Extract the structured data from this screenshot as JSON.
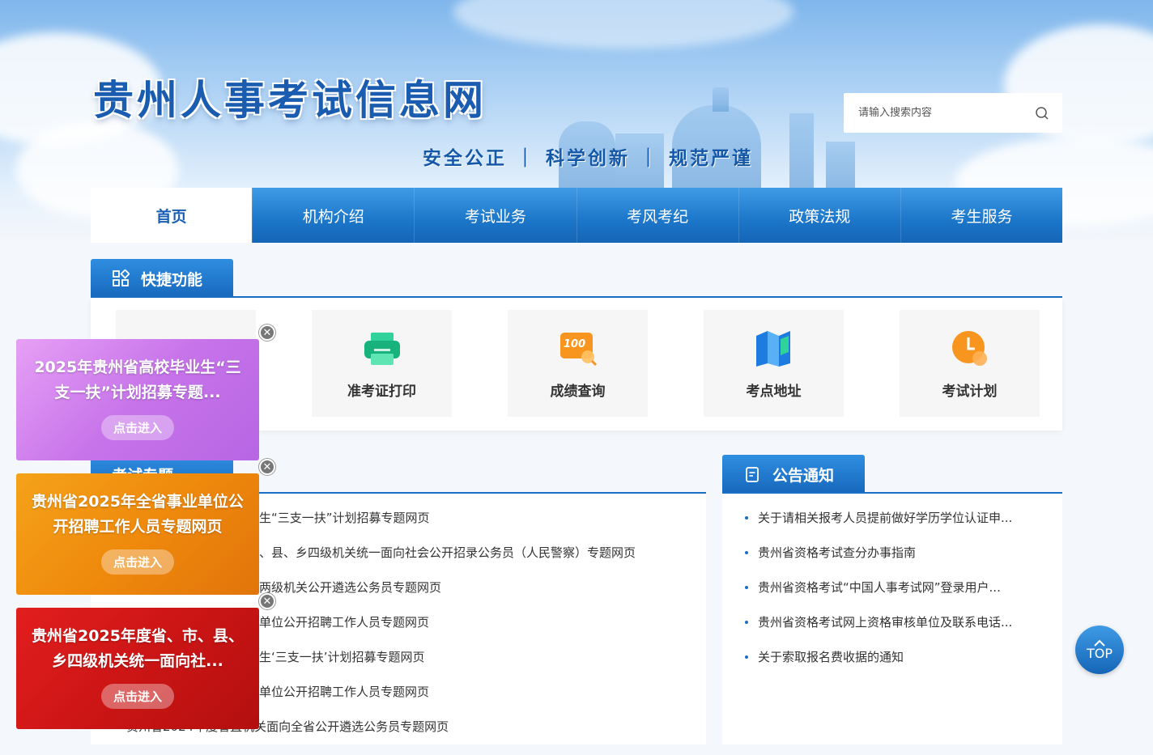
{
  "site": {
    "title": "贵州人事考试信息网",
    "slogan": "安全公正 ｜ 科学创新 ｜ 规范严谨"
  },
  "search": {
    "placeholder": "请输入搜索内容",
    "icon": "search-icon"
  },
  "nav": {
    "items": [
      {
        "label": "首页",
        "active": true
      },
      {
        "label": "机构介绍"
      },
      {
        "label": "考试业务"
      },
      {
        "label": "考风考纪"
      },
      {
        "label": "政策法规"
      },
      {
        "label": "考生服务"
      }
    ]
  },
  "quick": {
    "title": "快捷功能",
    "icon": "grid-icon",
    "items": [
      {
        "label": "",
        "icon": "blue-icon"
      },
      {
        "label": "准考证打印",
        "icon": "printer-icon"
      },
      {
        "label": "成绩查询",
        "icon": "score-icon",
        "badge": "100"
      },
      {
        "label": "考点地址",
        "icon": "map-icon"
      },
      {
        "label": "考试计划",
        "icon": "clock-icon"
      }
    ]
  },
  "topics": {
    "title": "考试专题",
    "items": [
      "生“三支一扶”计划招募专题网页",
      "、县、乡四级机关统一面向社会公开招录公务员（人民警察）专题网页",
      "两级机关公开遴选公务员专题网页",
      "单位公开招聘工作人员专题网页",
      "生‘三支一扶’计划招募专题网页",
      "单位公开招聘工作人员专题网页",
      "贵州省2024年度省直机关面向全省公开遴选公务员专题网页"
    ]
  },
  "notices": {
    "title": "公告通知",
    "icon": "document-icon",
    "items": [
      "关于请相关报考人员提前做好学历学位认证申...",
      "贵州省资格考试查分办事指南",
      "贵州省资格考试“中国人事考试网”登录用户...",
      "贵州省资格考试网上资格审核单位及联系电话...",
      "关于索取报名费收据的通知"
    ]
  },
  "floats": [
    {
      "title": "2025年贵州省高校毕业生“三支一扶”计划招募专题...",
      "button": "点击进入",
      "color": "#d47ef0"
    },
    {
      "title": "贵州省2025年全省事业单位公开招聘工作人员专题网页",
      "button": "点击进入",
      "color": "#ef8a0c"
    },
    {
      "title": "贵州省2025年度省、市、县、乡四级机关统一面向社...",
      "button": "点击进入",
      "color": "#cc1515"
    }
  ],
  "close_glyph": "✕",
  "totop": {
    "label": "TOP"
  },
  "colors": {
    "primary": "#1a6fc4",
    "nav_active_text": "#1a5fb4"
  }
}
